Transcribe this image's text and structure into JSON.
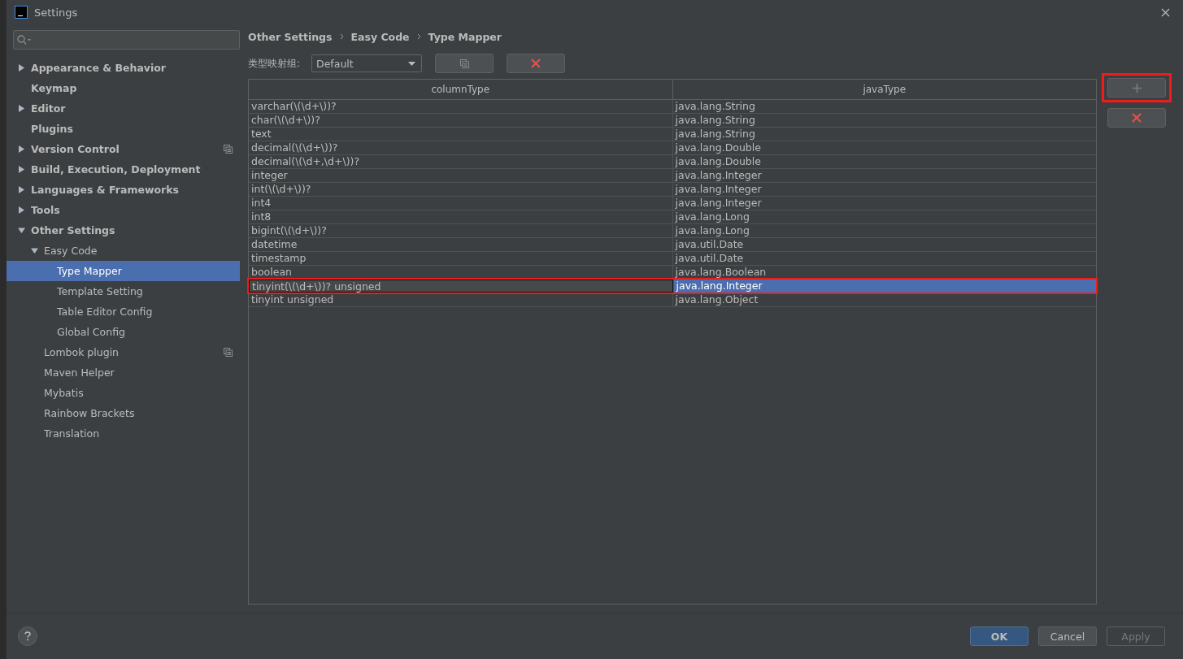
{
  "window": {
    "title": "Settings"
  },
  "tree": [
    {
      "label": "Appearance & Behavior",
      "expanded": false,
      "has_children": true,
      "selected": false,
      "project_level": false
    },
    {
      "label": "Keymap",
      "has_children": false,
      "selected": false,
      "project_level": false
    },
    {
      "label": "Editor",
      "expanded": false,
      "has_children": true,
      "selected": false,
      "project_level": false
    },
    {
      "label": "Plugins",
      "has_children": false,
      "selected": false,
      "project_level": false
    },
    {
      "label": "Version Control",
      "expanded": false,
      "has_children": true,
      "selected": false,
      "project_level": true
    },
    {
      "label": "Build, Execution, Deployment",
      "expanded": false,
      "has_children": true,
      "selected": false,
      "project_level": false
    },
    {
      "label": "Languages & Frameworks",
      "expanded": false,
      "has_children": true,
      "selected": false,
      "project_level": false
    },
    {
      "label": "Tools",
      "expanded": false,
      "has_children": true,
      "selected": false,
      "project_level": false
    },
    {
      "label": "Other Settings",
      "expanded": true,
      "has_children": true,
      "selected": false,
      "project_level": false,
      "children": [
        {
          "label": "Easy Code",
          "expanded": true,
          "has_children": true,
          "selected": false,
          "project_level": false,
          "children": [
            {
              "label": "Type Mapper",
              "has_children": false,
              "selected": true,
              "project_level": false
            },
            {
              "label": "Template Setting",
              "has_children": false,
              "selected": false,
              "project_level": false
            },
            {
              "label": "Table Editor Config",
              "has_children": false,
              "selected": false,
              "project_level": false
            },
            {
              "label": "Global Config",
              "has_children": false,
              "selected": false,
              "project_level": false
            }
          ]
        },
        {
          "label": "Lombok plugin",
          "has_children": false,
          "selected": false,
          "project_level": true
        },
        {
          "label": "Maven Helper",
          "has_children": false,
          "selected": false,
          "project_level": false
        },
        {
          "label": "Mybatis",
          "has_children": false,
          "selected": false,
          "project_level": false
        },
        {
          "label": "Rainbow Brackets",
          "has_children": false,
          "selected": false,
          "project_level": false
        },
        {
          "label": "Translation",
          "has_children": false,
          "selected": false,
          "project_level": false
        }
      ]
    }
  ],
  "breadcrumbs": [
    "Other Settings",
    "Easy Code",
    "Type Mapper"
  ],
  "group": {
    "label": "类型映射组:",
    "value": "Default"
  },
  "table": {
    "columns": [
      "columnType",
      "javaType"
    ],
    "rows": [
      {
        "cells": [
          "varchar(\\(\\d+\\))?",
          "java.lang.String"
        ],
        "selected": false,
        "highlighted": false
      },
      {
        "cells": [
          "char(\\(\\d+\\))?",
          "java.lang.String"
        ],
        "selected": false,
        "highlighted": false
      },
      {
        "cells": [
          "text",
          "java.lang.String"
        ],
        "selected": false,
        "highlighted": false
      },
      {
        "cells": [
          "decimal(\\(\\d+\\))?",
          "java.lang.Double"
        ],
        "selected": false,
        "highlighted": false
      },
      {
        "cells": [
          "decimal(\\(\\d+,\\d+\\))?",
          "java.lang.Double"
        ],
        "selected": false,
        "highlighted": false
      },
      {
        "cells": [
          "integer",
          "java.lang.Integer"
        ],
        "selected": false,
        "highlighted": false
      },
      {
        "cells": [
          "int(\\(\\d+\\))?",
          "java.lang.Integer"
        ],
        "selected": false,
        "highlighted": false
      },
      {
        "cells": [
          "int4",
          "java.lang.Integer"
        ],
        "selected": false,
        "highlighted": false
      },
      {
        "cells": [
          "int8",
          "java.lang.Long"
        ],
        "selected": false,
        "highlighted": false
      },
      {
        "cells": [
          "bigint(\\(\\d+\\))?",
          "java.lang.Long"
        ],
        "selected": false,
        "highlighted": false
      },
      {
        "cells": [
          "datetime",
          "java.util.Date"
        ],
        "selected": false,
        "highlighted": false
      },
      {
        "cells": [
          "timestamp",
          "java.util.Date"
        ],
        "selected": false,
        "highlighted": false
      },
      {
        "cells": [
          "boolean",
          "java.lang.Boolean"
        ],
        "selected": false,
        "highlighted": false
      },
      {
        "cells": [
          "tinyint(\\(\\d+\\))? unsigned",
          "java.lang.Integer"
        ],
        "selected": true,
        "highlighted": true
      },
      {
        "cells": [
          "tinyint unsigned",
          "java.lang.Object"
        ],
        "selected": false,
        "highlighted": false
      }
    ]
  },
  "side_buttons": [
    {
      "kind": "add",
      "highlighted": true
    },
    {
      "kind": "remove",
      "highlighted": false
    }
  ],
  "footer_buttons": [
    {
      "label": "OK",
      "kind": "primary",
      "disabled": false
    },
    {
      "label": "Cancel",
      "kind": "normal",
      "disabled": false
    },
    {
      "label": "Apply",
      "kind": "normal",
      "disabled": true
    }
  ]
}
